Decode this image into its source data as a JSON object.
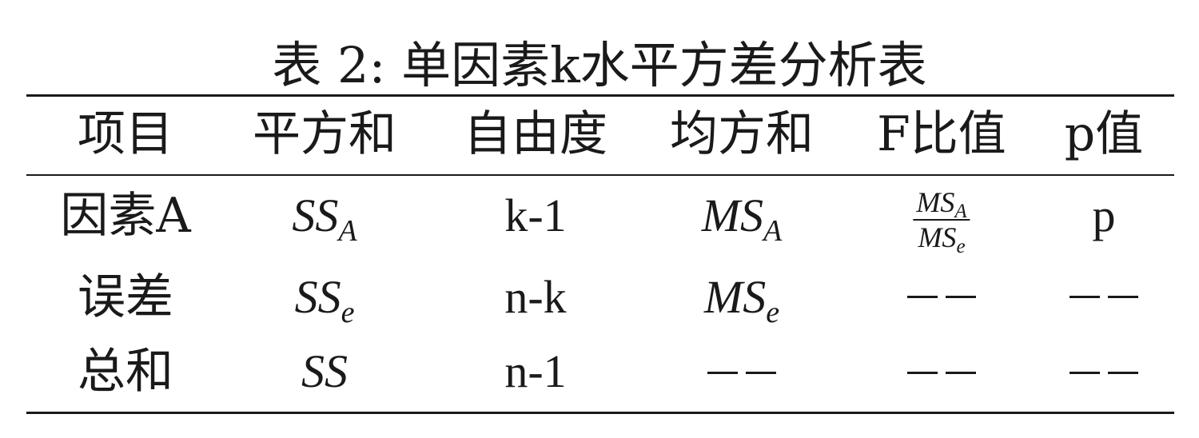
{
  "caption": "表 2: 单因素k水平方差分析表",
  "headers": [
    "项目",
    "平方和",
    "自由度",
    "均方和",
    "F比值",
    "p值"
  ],
  "rows": [
    {
      "item": "因素A",
      "ss": "SS",
      "ss_sub": "A",
      "df": "k-1",
      "ms": "MS",
      "ms_sub": "A",
      "f_num": "MS",
      "f_num_sub": "A",
      "f_den": "MS",
      "f_den_sub": "e",
      "p": "p"
    },
    {
      "item": "误差",
      "ss": "SS",
      "ss_sub": "e",
      "df": "n-k",
      "ms": "MS",
      "ms_sub": "e",
      "f": "−−",
      "p": "−−"
    },
    {
      "item": "总和",
      "ss": "SS",
      "df": "n-1",
      "ms": "−−",
      "f": "−−",
      "p": "−−"
    }
  ]
}
